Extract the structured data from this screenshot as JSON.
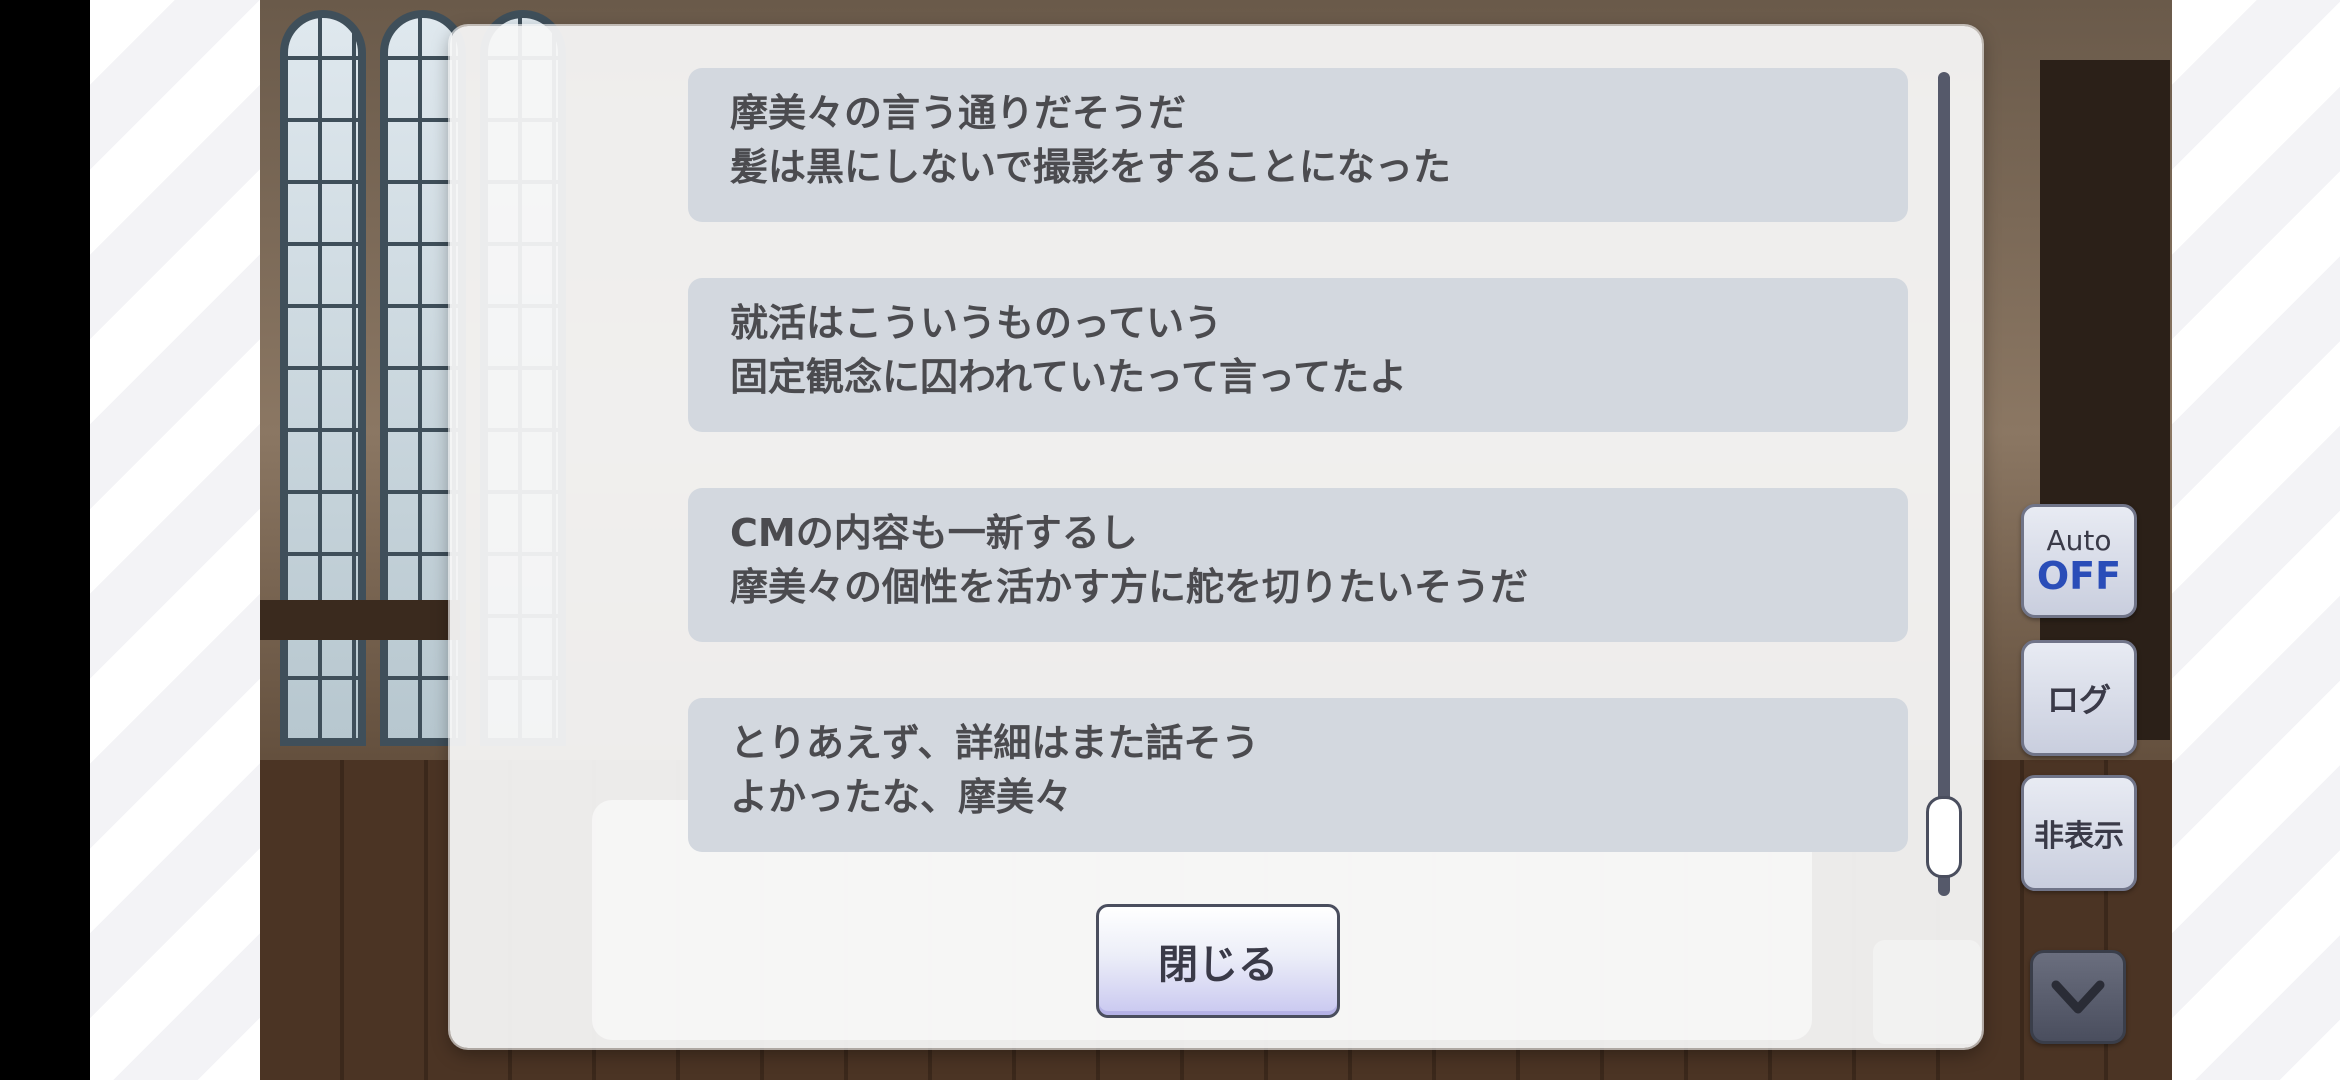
{
  "log": {
    "entries": [
      {
        "lines": [
          "摩美々の言う通りだそうだ",
          "髪は黒にしないで撮影をすることになった"
        ]
      },
      {
        "lines": [
          "就活はこういうものっていう",
          "固定観念に囚われていたって言ってたよ"
        ]
      },
      {
        "lines": [
          "CMの内容も一新するし",
          "摩美々の個性を活かす方に舵を切りたいそうだ"
        ]
      },
      {
        "lines": [
          "とりあえず、詳細はまた話そう",
          "よかったな、摩美々"
        ]
      }
    ],
    "close_label": "閉じる"
  },
  "controls": {
    "auto_label": "Auto",
    "auto_state": "OFF",
    "log_label": "ログ",
    "hide_label": "非表示",
    "down_icon": "chevron-down-icon"
  },
  "colors": {
    "entry_bg": "#d3d8df",
    "text": "#4b4b4f",
    "auto_off": "#2a4db8",
    "close_accent": "#c9c8f0"
  }
}
